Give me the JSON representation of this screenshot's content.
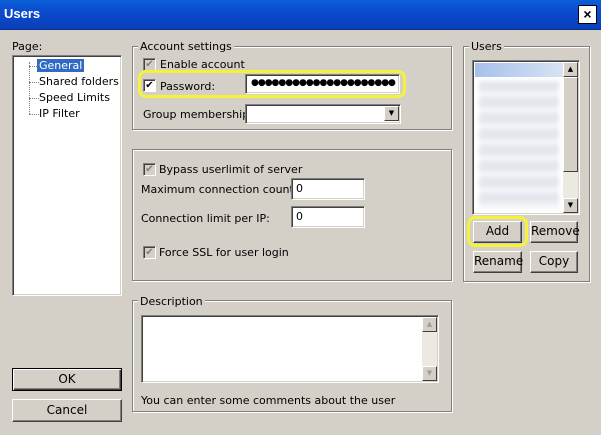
{
  "window": {
    "title": "Users",
    "close_symbol": "×"
  },
  "page_tree": {
    "label": "Page:",
    "items": [
      "General",
      "Shared folders",
      "Speed Limits",
      "IP Filter"
    ],
    "selected": "General"
  },
  "account_settings": {
    "group_title": "Account settings",
    "enable_account_label": "Enable account",
    "password_label": "Password:",
    "password_value": "●●●●●●●●●●●●●●●●●●●●●",
    "group_membership_label": "Group membership:",
    "group_membership_value": ""
  },
  "limits": {
    "bypass_label": "Bypass userlimit of server",
    "max_conn_label": "Maximum connection count:",
    "max_conn_value": "0",
    "per_ip_label": "Connection limit per IP:",
    "per_ip_value": "0",
    "ssl_label": "Force SSL for user login"
  },
  "description": {
    "group_title": "Description",
    "value": "",
    "hint": "You can enter some comments about the user"
  },
  "users": {
    "group_title": "Users",
    "add_label": "Add",
    "remove_label": "Remove",
    "rename_label": "Rename",
    "copy_label": "Copy"
  },
  "footer": {
    "ok_label": "OK",
    "cancel_label": "Cancel"
  },
  "icons": {
    "check": "✔",
    "arrow_up": "▲",
    "arrow_down": "▼"
  },
  "colors": {
    "titlebar": "#0b4bd0",
    "selection": "#316ac5",
    "highlight": "#f5f23a",
    "dialog_bg": "#d4d0c8"
  }
}
